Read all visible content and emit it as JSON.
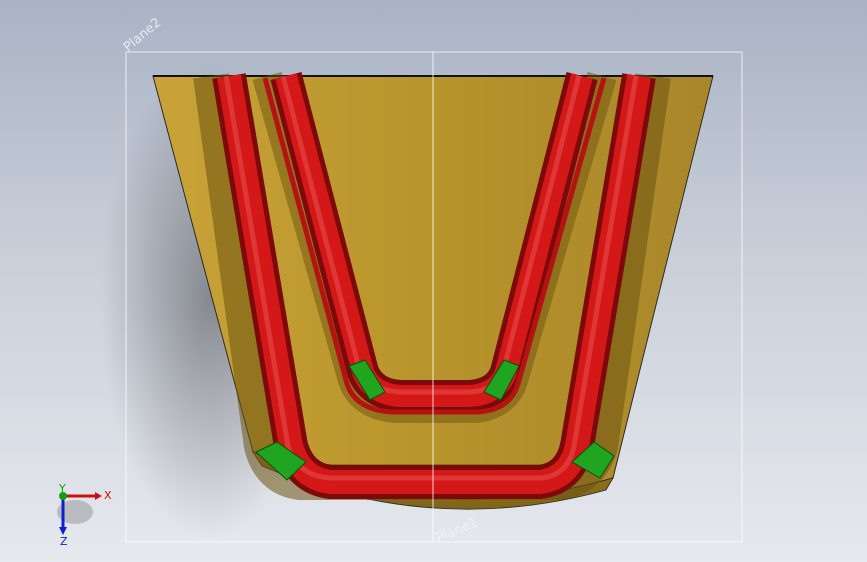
{
  "viewport": {
    "background_top": "#a9b3c4",
    "background_bottom": "#e6e9ee"
  },
  "planes": {
    "plane1_label": "Plane1",
    "plane2_label": "Plane2"
  },
  "model": {
    "body_color": "#b8942c",
    "tube_color": "#cc1414",
    "joint_color": "#1fa51f"
  },
  "triad": {
    "x_label": "X",
    "y_label": "Y",
    "z_label": "Z",
    "x_color": "#cc1010",
    "y_color": "#10a010",
    "z_color": "#1020cc"
  }
}
